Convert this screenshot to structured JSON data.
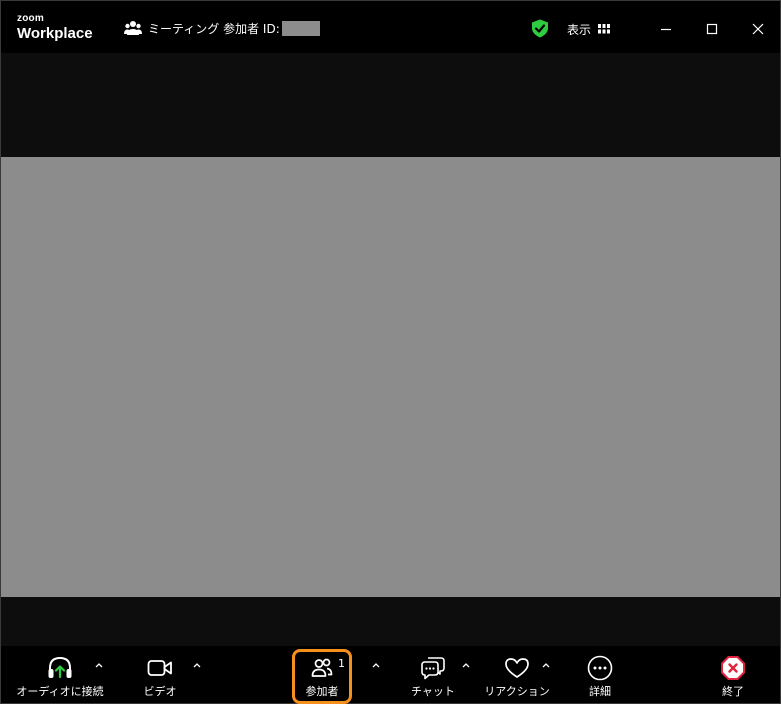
{
  "app": {
    "logo_small": "zoom",
    "logo_big": "Workplace"
  },
  "titlebar": {
    "meeting_label": "ミーティング 参加者 ID:",
    "view_label": "表示",
    "icons": [
      "participants-icon",
      "shield-check-icon",
      "grid-view-icon",
      "minimize-icon",
      "maximize-icon",
      "close-icon"
    ]
  },
  "toolbar": {
    "audio_label": "オーディオに接続",
    "video_label": "ビデオ",
    "participants_label": "参加者",
    "participants_count": "1",
    "chat_label": "チャット",
    "reactions_label": "リアクション",
    "more_label": "詳細",
    "end_label": "終了"
  },
  "colors": {
    "accent_green": "#2ecc40",
    "highlight_orange": "#f5901e",
    "end_red": "#e0243f",
    "video_tile": "#8c8c8c"
  }
}
